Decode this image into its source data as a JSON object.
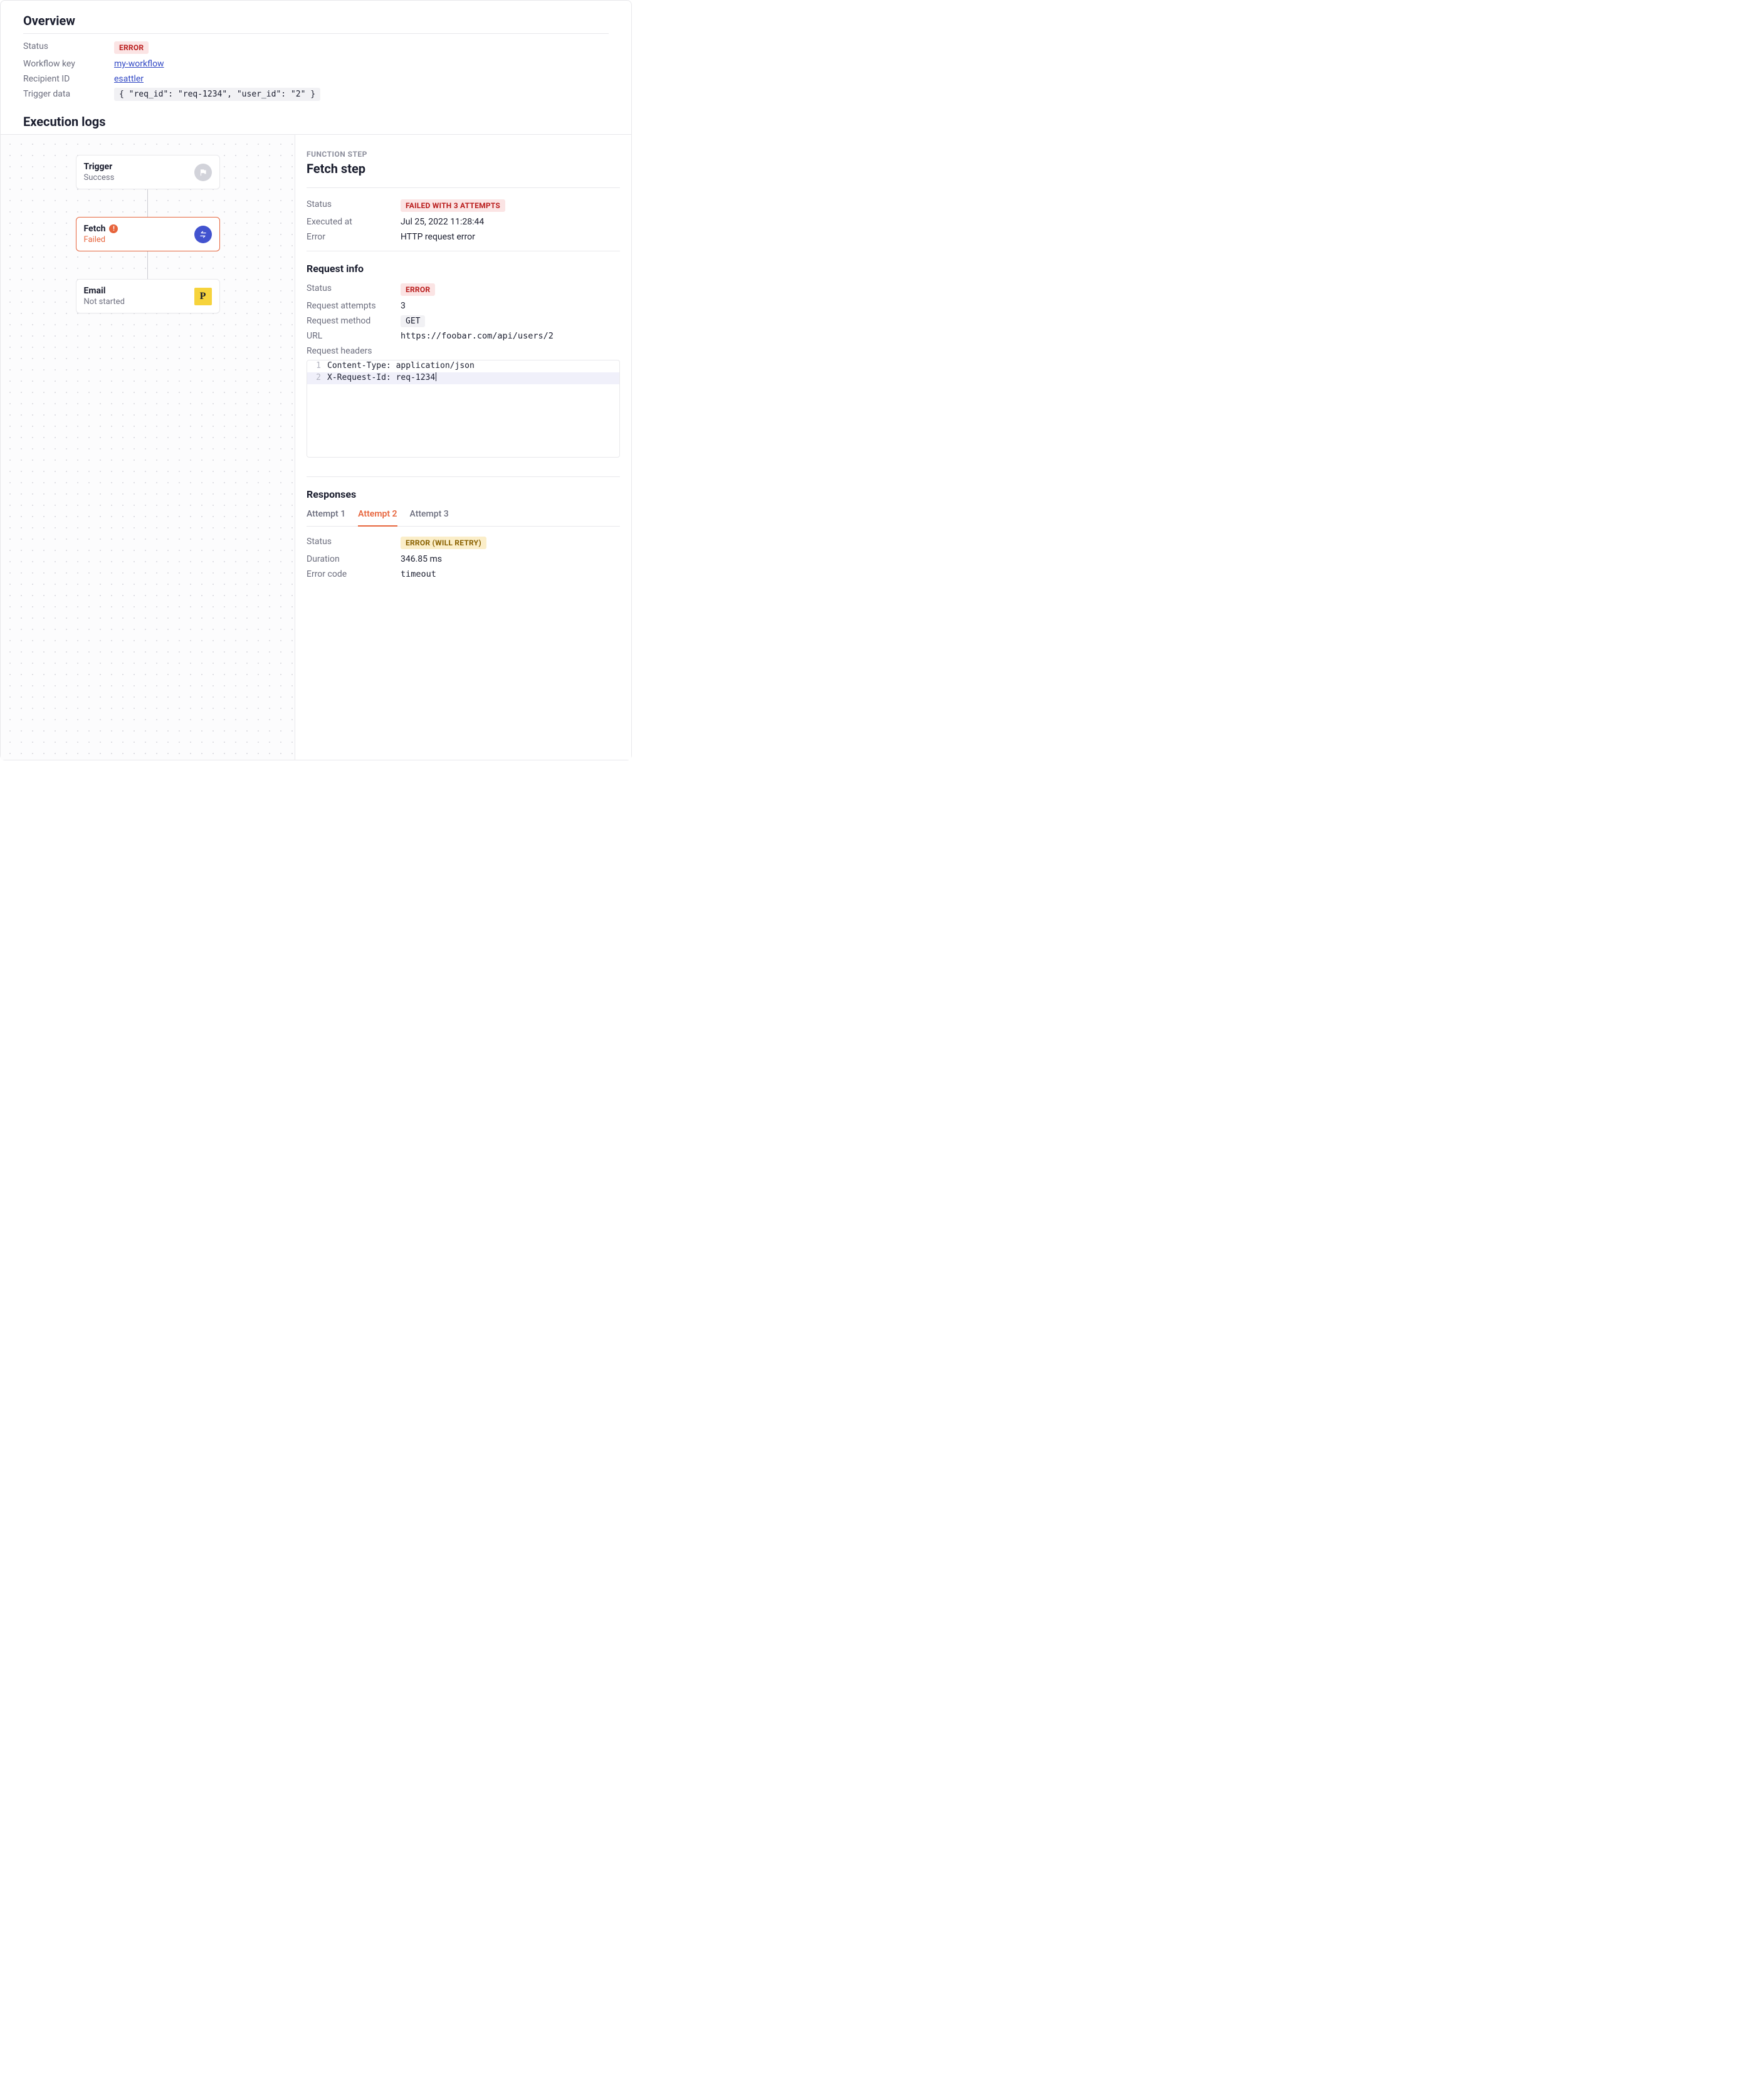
{
  "overview": {
    "title": "Overview",
    "status_label": "Status",
    "status_badge": "ERROR",
    "workflow_key_label": "Workflow key",
    "workflow_key": "my-workflow",
    "recipient_label": "Recipient ID",
    "recipient": "esattler",
    "trigger_data_label": "Trigger data",
    "trigger_data": "{ \"req_id\": \"req-1234\", \"user_id\": \"2\" }"
  },
  "exec": {
    "title": "Execution logs",
    "nodes": {
      "trigger": {
        "title": "Trigger",
        "sub": "Success"
      },
      "fetch": {
        "title": "Fetch",
        "sub": "Failed"
      },
      "email": {
        "title": "Email",
        "sub": "Not started"
      }
    }
  },
  "detail": {
    "eyebrow": "FUNCTION STEP",
    "title": "Fetch step",
    "status_label": "Status",
    "status_badge": "FAILED WITH 3 ATTEMPTS",
    "executed_label": "Executed at",
    "executed_at": "Jul 25, 2022 11:28:44",
    "error_label": "Error",
    "error": "HTTP request error",
    "request": {
      "heading": "Request info",
      "status_label": "Status",
      "status_badge": "ERROR",
      "attempts_label": "Request attempts",
      "attempts": "3",
      "method_label": "Request method",
      "method": "GET",
      "url_label": "URL",
      "url": "https://foobar.com/api/users/2",
      "headers_label": "Request headers",
      "headers": [
        "Content-Type: application/json",
        "X-Request-Id: req-1234"
      ]
    },
    "responses": {
      "heading": "Responses",
      "tabs": [
        "Attempt 1",
        "Attempt 2",
        "Attempt 3"
      ],
      "active_tab": 1,
      "status_label": "Status",
      "status_badge": "ERROR (WILL RETRY)",
      "duration_label": "Duration",
      "duration": "346.85 ms",
      "code_label": "Error code",
      "code": "timeout"
    }
  }
}
